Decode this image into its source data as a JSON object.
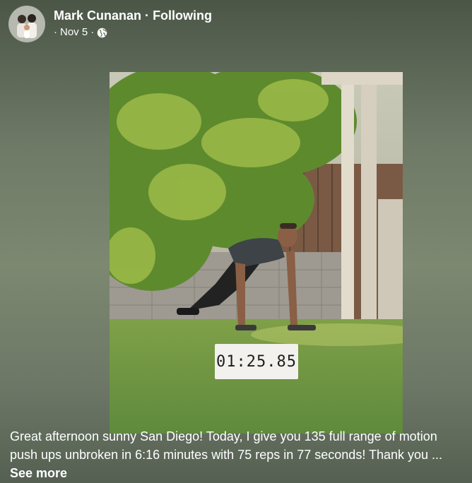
{
  "post": {
    "author": "Mark Cunanan",
    "separator": "·",
    "follow_status": "Following",
    "date": "Nov 5",
    "privacy_icon": "globe-icon"
  },
  "video": {
    "timer_text": "01:25.85"
  },
  "caption": {
    "text": "Great afternoon sunny San Diego!  Today, I give you 135 full range of motion push ups unbroken in 6:16 minutes with 75 reps in 77 seconds! Thank you ...",
    "see_more": "See more"
  },
  "colors": {
    "background_top": "#4b5647",
    "background_mid": "#7c8870",
    "text": "#ffffff",
    "timer_bg": "#f3f1ee"
  }
}
